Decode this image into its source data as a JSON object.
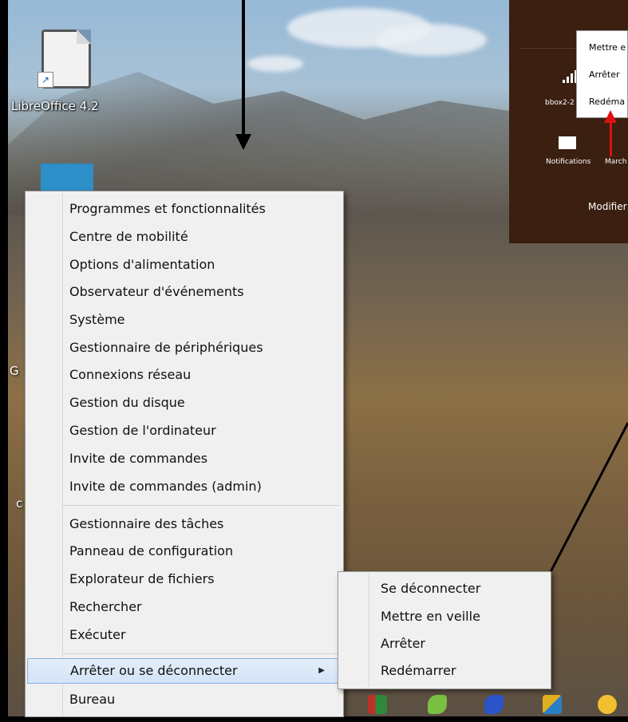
{
  "desktop": {
    "icons": [
      {
        "label": "LibreOffice 4.2"
      }
    ],
    "edge_letters": [
      "G",
      "c"
    ]
  },
  "context_menu": {
    "group1": [
      "Programmes et fonctionnalités",
      "Centre de mobilité",
      "Options d'alimentation",
      "Observateur d'événements",
      "Système",
      "Gestionnaire de périphériques",
      "Connexions réseau",
      "Gestion du disque",
      "Gestion de l'ordinateur",
      "Invite de commandes",
      "Invite de commandes (admin)"
    ],
    "group2": [
      "Gestionnaire des tâches",
      "Panneau de configuration",
      "Explorateur de fichiers",
      "Rechercher",
      "Exécuter"
    ],
    "highlighted": "Arrêter ou se déconnecter",
    "submenu_arrow": "▶",
    "last": "Bureau"
  },
  "submenu": {
    "items": [
      "Se déconnecter",
      "Mettre en veille",
      "Arrêter",
      "Redémarrer"
    ]
  },
  "charm_panel": {
    "power_popup": [
      "Mettre e",
      "Arrêter",
      "Redéma"
    ],
    "network_label": "bbox2-2",
    "notifications_label": "Notifications",
    "march_label": "March",
    "modifier_label": "Modifier"
  },
  "colors": {
    "menu_bg": "#f0f0f0",
    "highlight_border": "#8db2e3",
    "charm_bg": "#3b1f10",
    "red_arrow": "#e01010"
  }
}
